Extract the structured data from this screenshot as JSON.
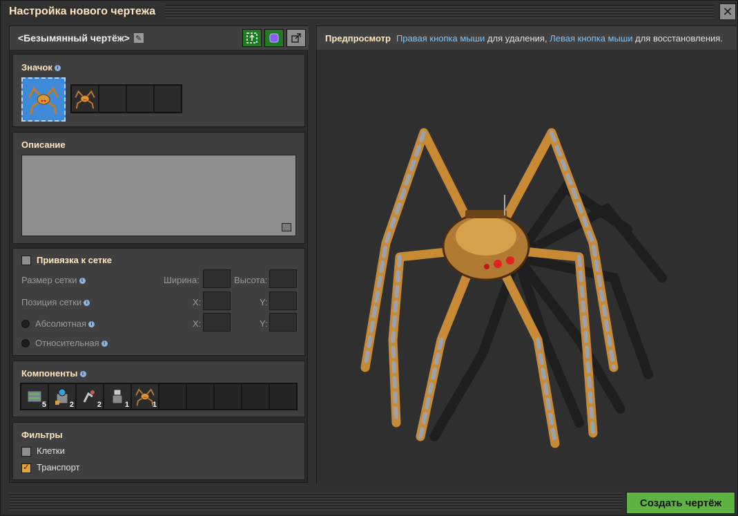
{
  "window": {
    "title": "Настройка нового чертежа",
    "close_icon": "close-icon"
  },
  "blueprint": {
    "name": "<Безымянный чертёж>",
    "header_buttons": [
      "select-area-icon",
      "blueprint-icon",
      "export-icon"
    ]
  },
  "icon_section": {
    "title": "Значок",
    "selected_icon": "spidertron-icon",
    "slots": [
      "spidertron-icon",
      "",
      "",
      ""
    ]
  },
  "description": {
    "title": "Описание",
    "value": ""
  },
  "grid": {
    "snap_label": "Привязка к сетке",
    "snap_checked": false,
    "size_label": "Размер сетки",
    "width_label": "Ширина:",
    "height_label": "Высота:",
    "position_label": "Позиция сетки",
    "x_label": "X:",
    "y_label": "Y:",
    "absolute_label": "Абсолютная",
    "relative_label": "Относительная"
  },
  "components": {
    "title": "Компоненты",
    "items": [
      {
        "icon": "battery-icon",
        "count": "5"
      },
      {
        "icon": "roboport-icon",
        "count": "2"
      },
      {
        "icon": "robot-icon",
        "count": "2"
      },
      {
        "icon": "turret-icon",
        "count": "1"
      },
      {
        "icon": "spidertron-icon",
        "count": "1"
      }
    ],
    "empty_slots": 5
  },
  "filters": {
    "title": "Фильтры",
    "items": [
      {
        "label": "Клетки",
        "checked": false
      },
      {
        "label": "Транспорт",
        "checked": true
      }
    ]
  },
  "preview": {
    "title": "Предпросмотр",
    "right_click": "Правая кнопка мыши",
    "remove_text": "для удаления,",
    "left_click": "Левая кнопка мыши",
    "restore_text": "для восстановления."
  },
  "actions": {
    "create_label": "Создать чертёж"
  },
  "colors": {
    "accent": "#ffe6c0",
    "create_button": "#5eb342",
    "highlight": "#7ec4f7",
    "checkbox_checked": "#e4a33a"
  }
}
